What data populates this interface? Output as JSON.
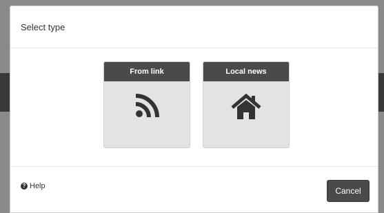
{
  "dialog": {
    "title": "Select type"
  },
  "types": [
    {
      "label": "From link",
      "icon": "rss-icon"
    },
    {
      "label": "Local news",
      "icon": "home-icon"
    }
  ],
  "footer": {
    "help_label": "Help",
    "help_icon": "question-circle-icon",
    "cancel_label": "Cancel"
  },
  "colors": {
    "card_header": "#4a4a4a",
    "card_body": "#e3e3e3",
    "icon": "#333333",
    "button": "#4a4a4a"
  }
}
